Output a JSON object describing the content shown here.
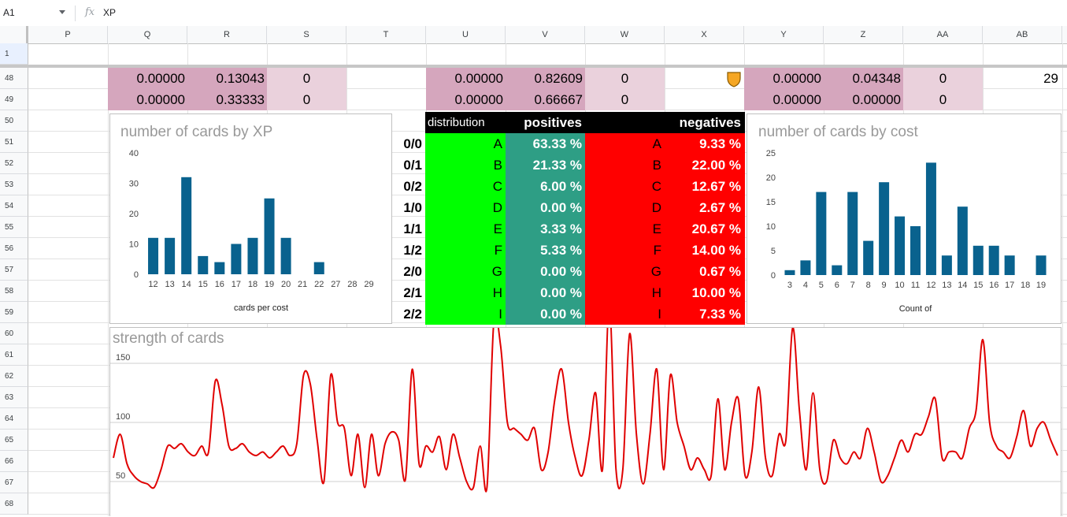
{
  "formula_bar": {
    "cell_ref": "A1",
    "fx": "fx",
    "value": "XP"
  },
  "columns": [
    "P",
    "Q",
    "R",
    "S",
    "T",
    "U",
    "V",
    "W",
    "X",
    "Y",
    "Z",
    "AA",
    "AB"
  ],
  "rows": [
    "1",
    "48",
    "49",
    "50",
    "51",
    "52",
    "53",
    "54",
    "55",
    "56",
    "57",
    "58",
    "59",
    "60",
    "61",
    "62",
    "63",
    "64",
    "65",
    "66",
    "67",
    "68"
  ],
  "row48": {
    "q": "0.00000",
    "r": "0.13043",
    "s": "0",
    "u": "0.00000",
    "v": "0.82609",
    "w": "0",
    "y": "0.00000",
    "z": "0.04348",
    "aa": "0",
    "ab": "29"
  },
  "row49": {
    "q": "0.00000",
    "r": "0.33333",
    "s": "0",
    "u": "0.00000",
    "v": "0.66667",
    "w": "0",
    "y": "0.00000",
    "z": "0.00000",
    "aa": "0"
  },
  "distribution_table": {
    "header_distribution": "distribution",
    "header_positives": "positives",
    "header_negatives": "negatives",
    "rows": [
      {
        "label": "0/0",
        "pos_letter": "A",
        "pos_pct": "63.33 %",
        "neg_letter": "A",
        "neg_pct": "9.33 %"
      },
      {
        "label": "0/1",
        "pos_letter": "B",
        "pos_pct": "21.33 %",
        "neg_letter": "B",
        "neg_pct": "22.00 %"
      },
      {
        "label": "0/2",
        "pos_letter": "C",
        "pos_pct": "6.00 %",
        "neg_letter": "C",
        "neg_pct": "12.67 %"
      },
      {
        "label": "1/0",
        "pos_letter": "D",
        "pos_pct": "0.00 %",
        "neg_letter": "D",
        "neg_pct": "2.67 %"
      },
      {
        "label": "1/1",
        "pos_letter": "E",
        "pos_pct": "3.33 %",
        "neg_letter": "E",
        "neg_pct": "20.67 %"
      },
      {
        "label": "1/2",
        "pos_letter": "F",
        "pos_pct": "5.33 %",
        "neg_letter": "F",
        "neg_pct": "14.00 %"
      },
      {
        "label": "2/0",
        "pos_letter": "G",
        "pos_pct": "0.00 %",
        "neg_letter": "G",
        "neg_pct": "0.67 %"
      },
      {
        "label": "2/1",
        "pos_letter": "H",
        "pos_pct": "0.00 %",
        "neg_letter": "H",
        "neg_pct": "10.00 %"
      },
      {
        "label": "2/2",
        "pos_letter": "I",
        "pos_pct": "0.00 %",
        "neg_letter": "I",
        "neg_pct": "7.33 %"
      }
    ]
  },
  "colors": {
    "bar": "#09628e",
    "pink_dark": "#d5a6bd",
    "pink_light": "#ead1dc",
    "green": "#00ff00",
    "teal": "#2e9e85",
    "red": "#ff0000",
    "line": "#e00000"
  },
  "chart_data": [
    {
      "type": "bar",
      "title": "number of cards by XP",
      "xlabel": "cards per cost",
      "ylabel": "",
      "ylim": [
        0,
        40
      ],
      "yticks": [
        0,
        10,
        20,
        30,
        40
      ],
      "categories": [
        "12",
        "13",
        "14",
        "15",
        "16",
        "17",
        "18",
        "19",
        "20",
        "21",
        "22",
        "27",
        "28",
        "29"
      ],
      "values": [
        12,
        12,
        32,
        6,
        4,
        10,
        12,
        25,
        12,
        0,
        4,
        0,
        0,
        0
      ]
    },
    {
      "type": "bar",
      "title": "number of cards by cost",
      "xlabel": "Count of",
      "ylabel": "",
      "ylim": [
        0,
        25
      ],
      "yticks": [
        0,
        5,
        10,
        15,
        20,
        25
      ],
      "categories": [
        "3",
        "4",
        "5",
        "6",
        "7",
        "8",
        "9",
        "10",
        "11",
        "12",
        "13",
        "14",
        "15",
        "16",
        "17",
        "18",
        "19"
      ],
      "values": [
        1,
        3,
        17,
        2,
        17,
        7,
        19,
        12,
        10,
        23,
        4,
        14,
        6,
        6,
        4,
        0,
        4
      ]
    },
    {
      "type": "line",
      "title": "strength of cards",
      "xlabel": "",
      "ylabel": "",
      "yticks": [
        50,
        100,
        150
      ],
      "ylim": [
        20,
        180
      ],
      "x_count": 140,
      "values": [
        70,
        90,
        65,
        55,
        50,
        48,
        45,
        60,
        80,
        78,
        82,
        75,
        72,
        80,
        75,
        135,
        115,
        80,
        78,
        82,
        75,
        72,
        75,
        70,
        75,
        80,
        72,
        82,
        140,
        132,
        85,
        50,
        140,
        100,
        95,
        55,
        90,
        45,
        90,
        55,
        82,
        92,
        85,
        52,
        145,
        65,
        80,
        75,
        88,
        60,
        90,
        70,
        50,
        45,
        80,
        45,
        185,
        165,
        100,
        95,
        90,
        85,
        95,
        60,
        75,
        120,
        145,
        100,
        70,
        55,
        85,
        125,
        60,
        200,
        60,
        60,
        175,
        90,
        48,
        90,
        145,
        60,
        140,
        100,
        80,
        60,
        70,
        60,
        55,
        120,
        60,
        100,
        120,
        55,
        75,
        130,
        70,
        55,
        90,
        85,
        180,
        110,
        60,
        125,
        60,
        50,
        85,
        70,
        65,
        75,
        70,
        95,
        75,
        50,
        55,
        70,
        85,
        75,
        90,
        90,
        105,
        120,
        70,
        75,
        75,
        70,
        95,
        110,
        170,
        100,
        80,
        75,
        70,
        88,
        110,
        80,
        95,
        100,
        85,
        72
      ]
    }
  ]
}
